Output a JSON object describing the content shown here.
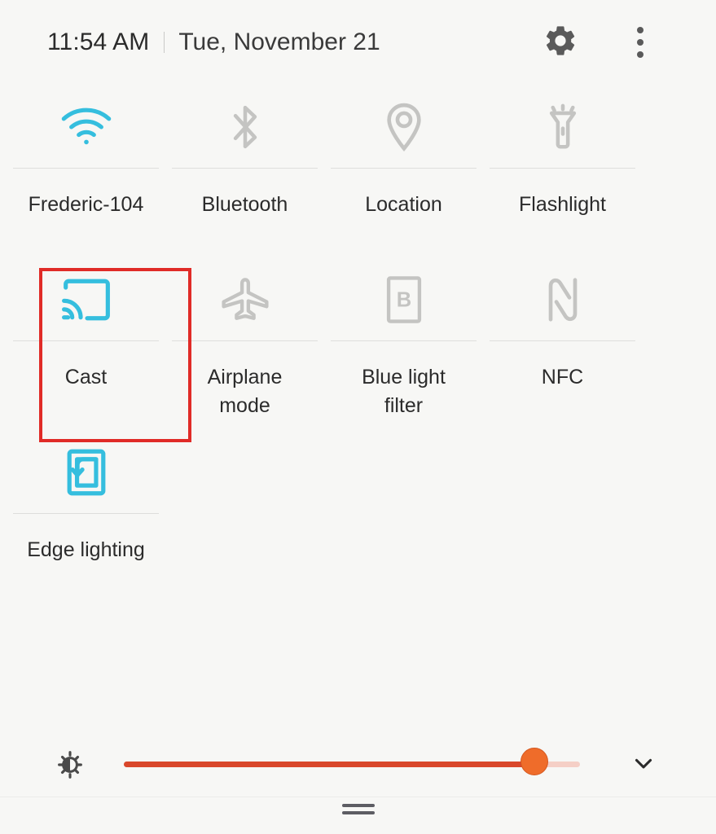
{
  "accent_colors": {
    "active_icon": "#35bede",
    "inactive_icon": "#c4c4c2",
    "highlight_box": "#e02b27",
    "slider_fill": "#d9472b",
    "slider_track": "#f5cfc6",
    "slider_thumb": "#ef6c2a",
    "background": "#f7f7f5",
    "text": "#2b2b2b"
  },
  "header": {
    "time": "11:54 AM",
    "date": "Tue, November 21",
    "gear_icon": "gear-icon",
    "overflow_icon": "overflow-menu-icon"
  },
  "tiles": [
    [
      {
        "id": "wifi",
        "label": "Frederic-104",
        "icon": "wifi-icon",
        "state": "on",
        "highlighted": false
      },
      {
        "id": "bluetooth",
        "label": "Bluetooth",
        "icon": "bluetooth-icon",
        "state": "off",
        "highlighted": false
      },
      {
        "id": "location",
        "label": "Location",
        "icon": "location-pin-icon",
        "state": "off",
        "highlighted": false
      },
      {
        "id": "flashlight",
        "label": "Flashlight",
        "icon": "flashlight-icon",
        "state": "off",
        "highlighted": false
      }
    ],
    [
      {
        "id": "cast",
        "label": "Cast",
        "icon": "cast-icon",
        "state": "on",
        "highlighted": true
      },
      {
        "id": "airplane",
        "label": "Airplane\nmode",
        "icon": "airplane-icon",
        "state": "off",
        "highlighted": false
      },
      {
        "id": "bluelight",
        "label": "Blue light\nfilter",
        "icon": "blue-light-icon",
        "state": "off",
        "highlighted": false
      },
      {
        "id": "nfc",
        "label": "NFC",
        "icon": "nfc-icon",
        "state": "off",
        "highlighted": false
      }
    ],
    [
      {
        "id": "edge-lighting",
        "label": "Edge lighting",
        "icon": "edge-lighting-icon",
        "state": "on",
        "highlighted": false
      }
    ]
  ],
  "brightness": {
    "icon": "auto-brightness-icon",
    "value_percent": 90,
    "expand_icon": "chevron-down-icon"
  },
  "bottom": {
    "handle": "drag-handle"
  }
}
